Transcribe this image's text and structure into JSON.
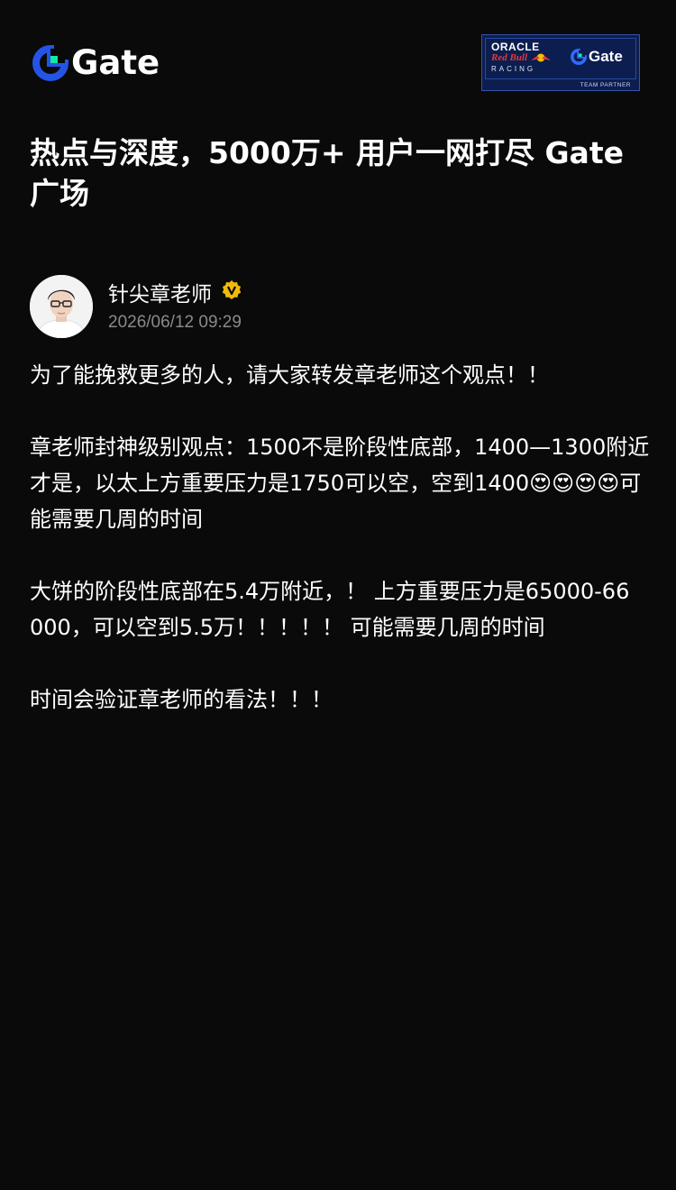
{
  "header": {
    "logo_text": "Gate",
    "partner_badge": {
      "oracle_text": "ORACLE",
      "redbull_text": "Red Bull",
      "racing_text": "RACING",
      "gate_text": "Gate",
      "team_partner_text": "TEAM PARTNER"
    }
  },
  "headline": "热点与深度，5000万+ 用户一网打尽 Gate 广场",
  "author": {
    "name": "针尖章老师",
    "verified_icon": "verified-v-icon",
    "post_time": "2026/06/12 09:29"
  },
  "post": {
    "paragraphs": [
      "为了能挽救更多的人，请大家转发章老师这个观点！！",
      "章老师封神级别观点：1500不是阶段性底部，1400—1300附近才是，以太上方重要压力是1750可以空，空到1400😍😍😍😍可能需要几周的时间",
      "大饼的阶段性底部在5.4万附近，！ 上方重要压力是65000-66 000，可以空到5.5万！！！！！ 可能需要几周的时间",
      "时间会验证章老师的看法！！！"
    ]
  },
  "colors": {
    "background": "#0a0a0a",
    "text": "#ffffff",
    "muted": "#8a8a8a",
    "gate_blue": "#2354e6",
    "gate_green": "#17e6a1",
    "verified_gold": "#f0b90b",
    "badge_navy": "#0c1d4f"
  }
}
